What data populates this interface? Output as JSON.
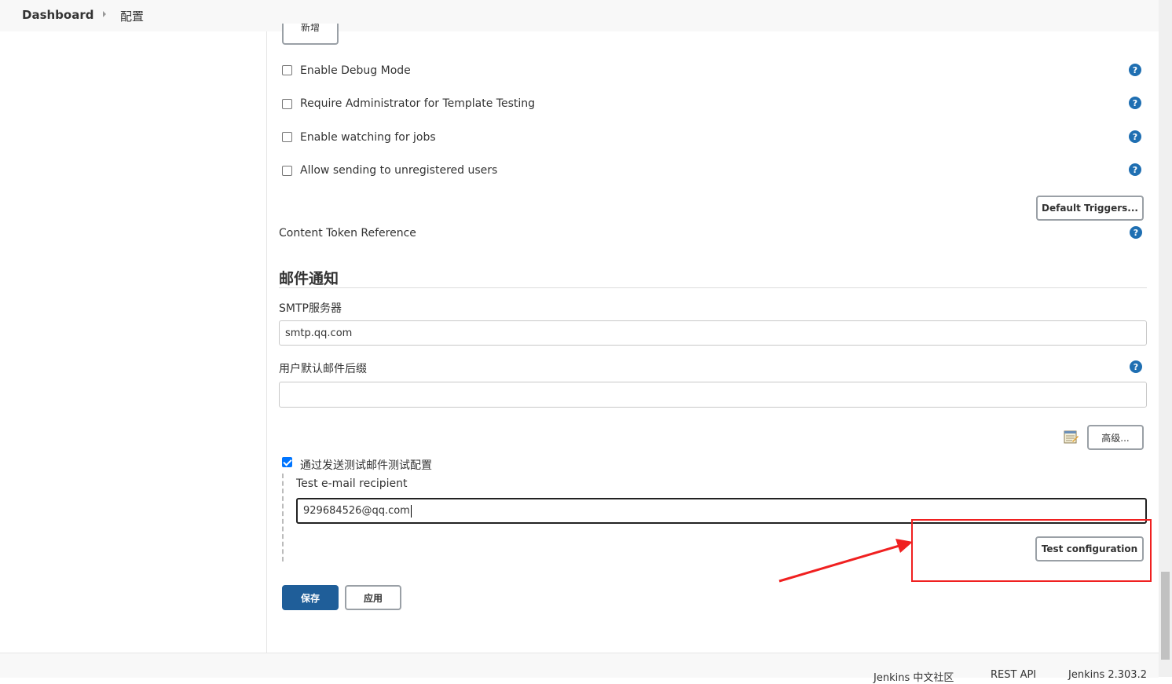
{
  "breadcrumb": {
    "home": "Dashboard",
    "page": "配置"
  },
  "top_button": {
    "label": "新增"
  },
  "checkboxes": [
    {
      "label": "Enable Debug Mode",
      "checked": false
    },
    {
      "label": "Require Administrator for Template Testing",
      "checked": false
    },
    {
      "label": "Enable watching for jobs",
      "checked": false
    },
    {
      "label": "Allow sending to unregistered users",
      "checked": false
    }
  ],
  "default_triggers": {
    "label": "Default Triggers..."
  },
  "content_token": {
    "label": "Content Token Reference"
  },
  "help": {
    "glyph": "?"
  },
  "email_section": {
    "title": "邮件通知",
    "smtp": {
      "label": "SMTP服务器",
      "value": "smtp.qq.com"
    },
    "suffix": {
      "label": "用户默认邮件后缀",
      "value": ""
    },
    "advanced_button": "高级...",
    "test_checkbox": {
      "label": "通过发送测试邮件测试配置",
      "checked": true
    },
    "recipient": {
      "label": "Test e-mail recipient",
      "value": "929684526@qq.com"
    },
    "test_button": "Test configuration"
  },
  "actions": {
    "save": "保存",
    "apply": "应用"
  },
  "footer": {
    "community": "Jenkins 中文社区",
    "rest_api": "REST API",
    "version": "Jenkins 2.303.2"
  },
  "colors": {
    "primary": "#1f5e99",
    "help": "#1f6fb2",
    "annotation": "#f02020",
    "checkbox_checked": "#0075ff"
  },
  "icons": [
    "chevron-right-icon",
    "help-icon",
    "notepad-icon",
    "arrow-annotation"
  ]
}
